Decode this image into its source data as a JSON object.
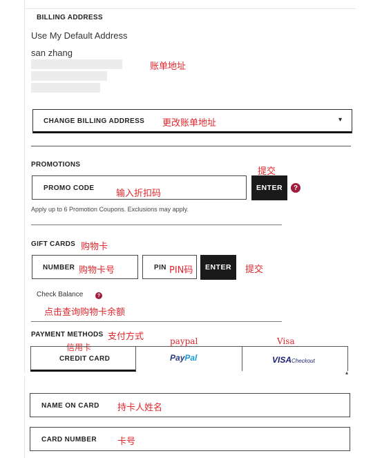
{
  "billing": {
    "heading": "BILLING ADDRESS",
    "default_label": "Use My Default Address",
    "name": "san zhang",
    "annotation": "账单地址",
    "change_label": "CHANGE BILLING ADDRESS",
    "change_annotation": "更改账单地址"
  },
  "promotions": {
    "heading": "PROMOTIONS",
    "promo_label": "PROMO CODE",
    "promo_annotation": "输入折扣码",
    "enter_label": "ENTER",
    "submit_annotation": "提交",
    "note": "Apply up to 6 Promotion Coupons. Exclusions may apply."
  },
  "gift_cards": {
    "heading": "GIFT CARDS",
    "heading_annotation": "购物卡",
    "number_label": "NUMBER",
    "number_annotation": "购物卡号",
    "pin_label": "PIN",
    "pin_annotation": "PIN码",
    "enter_label": "ENTER",
    "submit_annotation": "提交",
    "check_balance": "Check Balance",
    "check_annotation": "点击查询购物卡余额"
  },
  "payment": {
    "heading": "PAYMENT METHODS",
    "heading_annotation": "支付方式",
    "tabs": [
      {
        "label": "CREDIT CARD",
        "annotation": "信用卡"
      },
      {
        "label": "PayPal",
        "annotation": "paypal"
      },
      {
        "label": "VISA",
        "sub": "Checkout",
        "annotation": "Visa"
      }
    ]
  },
  "card": {
    "name_label": "NAME ON CARD",
    "name_annotation": "持卡人姓名",
    "number_label": "CARD NUMBER",
    "number_annotation": "卡号"
  },
  "icons": {
    "help": "?",
    "dropdown_arrow": "▾"
  },
  "colors": {
    "annotation": "#e0262b",
    "help_icon": "#a01c3c",
    "button_dark": "#1a1a1a",
    "paypal_dark": "#253b80",
    "paypal_light": "#179bd7",
    "visa_blue": "#1a1f71"
  }
}
